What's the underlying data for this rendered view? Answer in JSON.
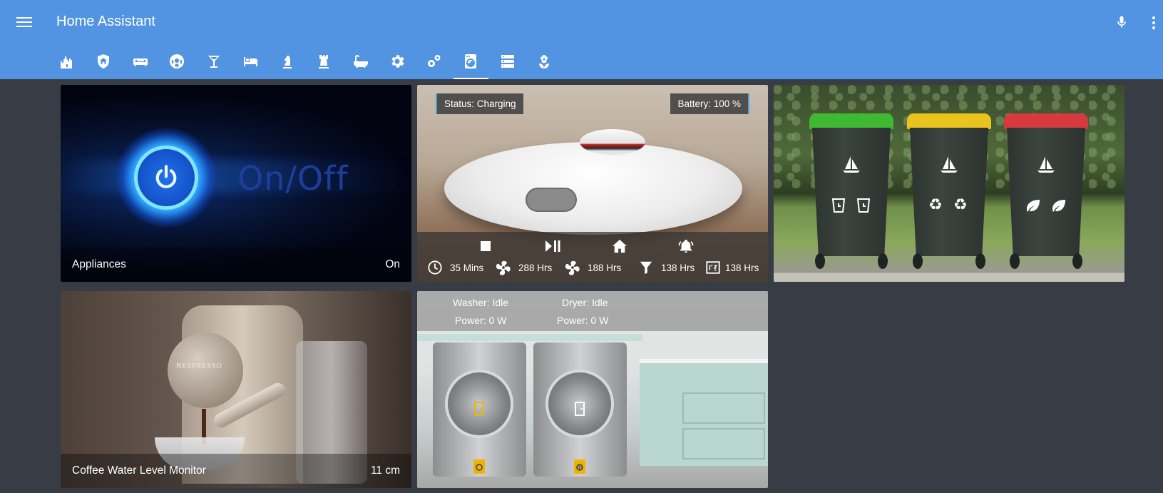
{
  "header": {
    "title": "Home Assistant",
    "menu_icon": "menu-icon",
    "mic_icon": "microphone-icon",
    "more_icon": "dots-vertical-icon",
    "accent_color": "#5294e2"
  },
  "tabs": [
    {
      "icon": "castle-home-icon",
      "active": false
    },
    {
      "icon": "shield-home-icon",
      "active": false
    },
    {
      "icon": "sofa-icon",
      "active": false
    },
    {
      "icon": "soccer-ball-icon",
      "active": false
    },
    {
      "icon": "cocktail-glass-icon",
      "active": false
    },
    {
      "icon": "bed-icon",
      "active": false
    },
    {
      "icon": "chess-knight-icon",
      "active": false
    },
    {
      "icon": "chess-rook-icon",
      "active": false
    },
    {
      "icon": "bathtub-icon",
      "active": false
    },
    {
      "icon": "settings-gear-icon",
      "active": false
    },
    {
      "icon": "settings-gears-icon",
      "active": false
    },
    {
      "icon": "washing-machine-icon",
      "active": true
    },
    {
      "icon": "server-icon",
      "active": false
    },
    {
      "icon": "flower-icon",
      "active": false
    }
  ],
  "cards": {
    "appliances": {
      "name": "Appliances",
      "state": "On",
      "image_text": "On/Off"
    },
    "vacuum": {
      "status": "Status: Charging",
      "battery": "Battery: 100 %",
      "controls": [
        "stop-icon",
        "play-pause-icon",
        "home-icon",
        "bell-ring-icon"
      ],
      "stats": [
        {
          "icon": "clock-icon",
          "value": "35 Mins"
        },
        {
          "icon": "fan-icon",
          "value": "288 Hrs"
        },
        {
          "icon": "fan-icon",
          "value": "188 Hrs"
        },
        {
          "icon": "filter-icon",
          "value": "138 Hrs"
        },
        {
          "icon": "sensor-counter-icon",
          "value": "138 Hrs"
        }
      ]
    },
    "bins": {
      "lid_colors": [
        "#3fb833",
        "#e8c41d",
        "#d73a3e"
      ]
    },
    "coffee": {
      "name": "Coffee Water Level Monitor",
      "state": "11 cm",
      "brand_text": "NESPRESSO"
    },
    "laundry": {
      "washer_status": "Washer: Idle",
      "washer_power": "Power: 0 W",
      "dryer_status": "Dryer: Idle",
      "dryer_power": "Power: 0 W",
      "icon_color": "#f0b400"
    }
  }
}
